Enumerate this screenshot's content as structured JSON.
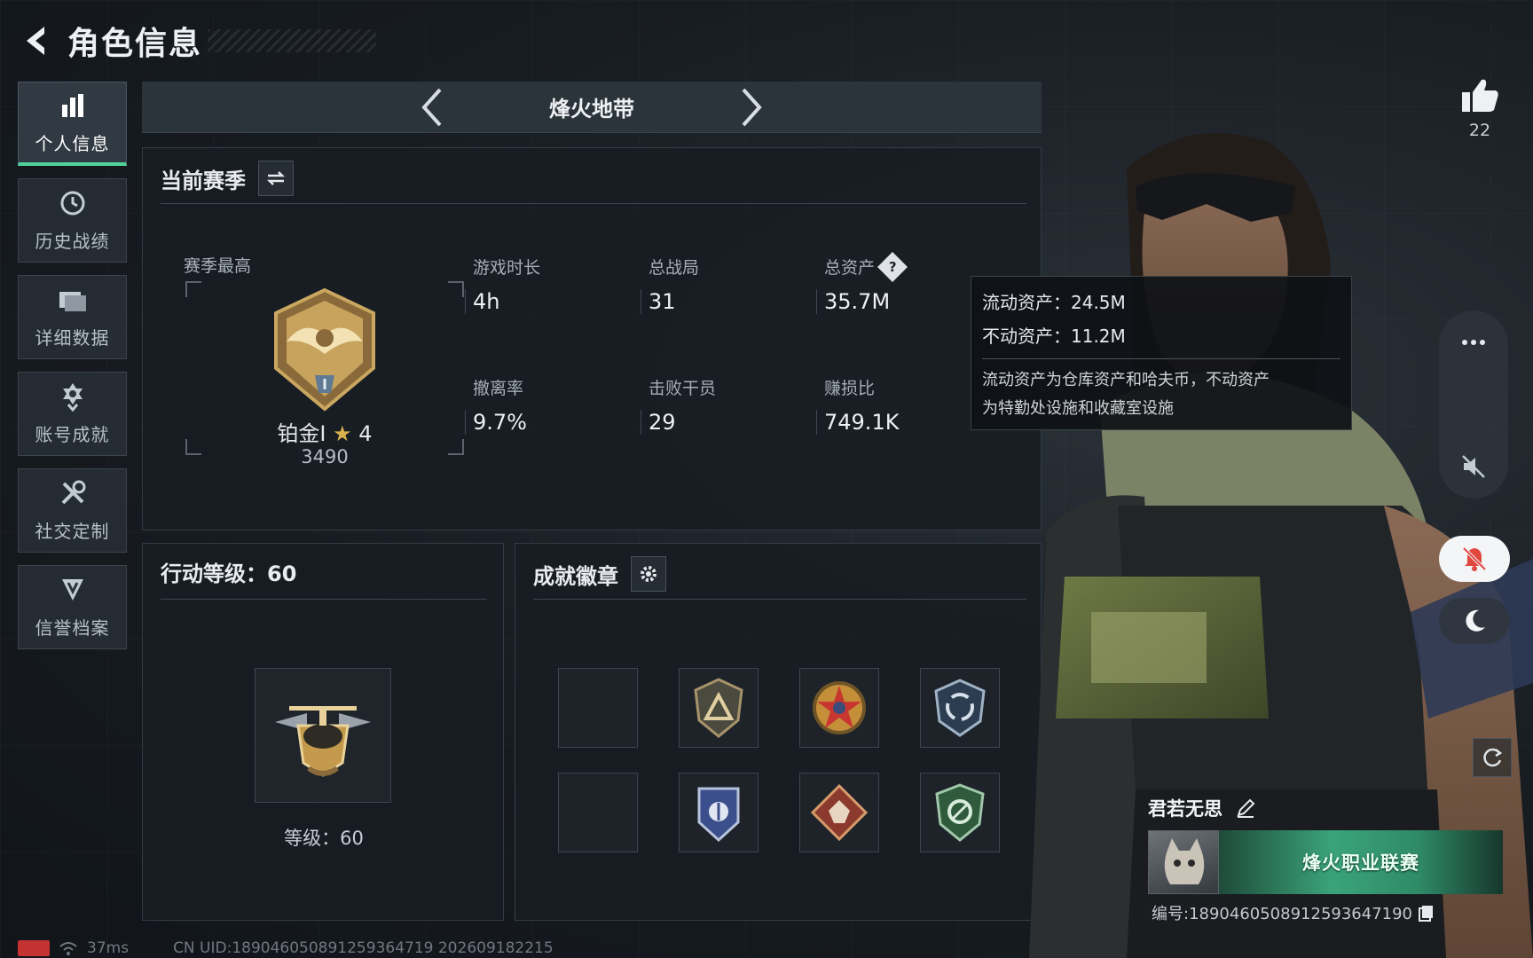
{
  "header": {
    "title": "角色信息"
  },
  "nav": {
    "items": [
      {
        "label": "个人信息",
        "icon": "bar-chart-icon",
        "active": true
      },
      {
        "label": "历史战绩",
        "icon": "clock-icon",
        "active": false
      },
      {
        "label": "详细数据",
        "icon": "folder-icon",
        "active": false
      },
      {
        "label": "账号成就",
        "icon": "medal-icon",
        "active": false
      },
      {
        "label": "社交定制",
        "icon": "tools-icon",
        "active": false
      },
      {
        "label": "信誉档案",
        "icon": "shield-badge-icon",
        "active": false
      }
    ]
  },
  "mode": {
    "title": "烽火地带"
  },
  "season": {
    "title": "当前赛季",
    "best_label": "赛季最高",
    "rank_name": "铂金I",
    "rank_stars": "4",
    "rank_score": "3490",
    "stats": [
      {
        "label": "游戏时长",
        "value": "4h"
      },
      {
        "label": "总战局",
        "value": "31"
      },
      {
        "label": "总资产",
        "value": "35.7M"
      },
      {
        "label": "撤离率",
        "value": "9.7%"
      },
      {
        "label": "击败干员",
        "value": "29"
      },
      {
        "label": "赚损比",
        "value": "749.1K"
      }
    ]
  },
  "tooltip": {
    "liquid": "流动资产：24.5M",
    "fixed": "不动资产：11.2M",
    "note_line1": "流动资产为仓库资产和哈夫币，不动资产",
    "note_line2": "为特勤处设施和收藏室设施"
  },
  "action_level": {
    "title": "行动等级：60",
    "level_text": "等级：60"
  },
  "badges": {
    "title": "成就徽章",
    "slots": [
      "empty",
      "triangle-shield-badge",
      "red-star-badge",
      "circular-arrows-badge",
      "empty",
      "blue-crest-badge",
      "wolf-diamond-badge",
      "green-shield-badge"
    ]
  },
  "likes": {
    "count": "22"
  },
  "player": {
    "name": "君若无思",
    "banner_text": "烽火职业联赛",
    "id_text": "编号:1890460508912593647190"
  },
  "footer": {
    "ping": "37ms",
    "uid_text": "CN UID:18904605089125936471​9 202609182215"
  },
  "colors": {
    "accent_green": "#4fd39a",
    "gold": "#d8b24a",
    "bell_bg": "#f4f5f6",
    "muted_red": "#e0473f"
  }
}
